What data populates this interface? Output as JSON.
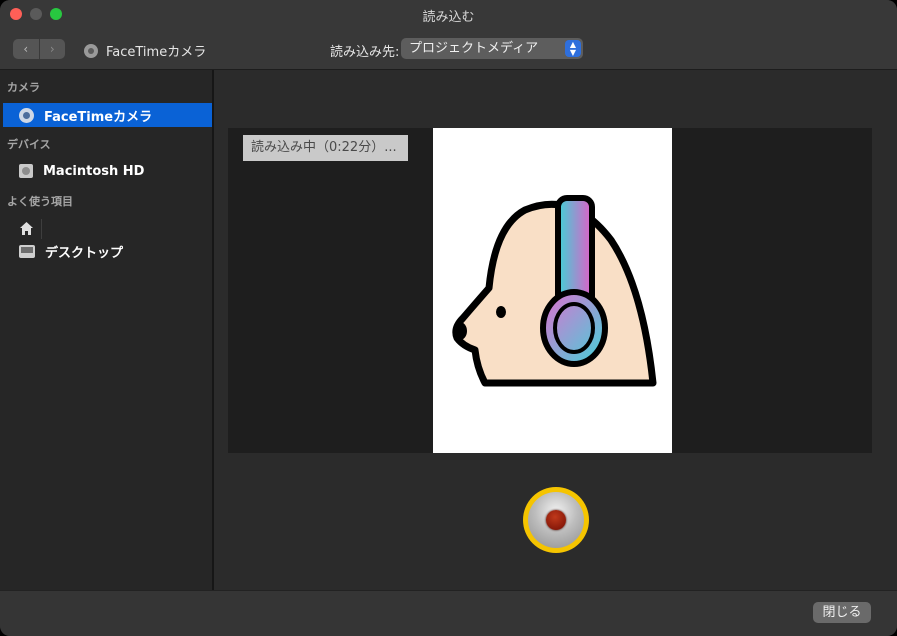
{
  "window": {
    "title": "読み込む"
  },
  "toolbar": {
    "back_icon": "chevron-left-icon",
    "forward_icon": "chevron-right-icon",
    "source_label": "FaceTimeカメラ",
    "destination_label": "読み込み先:",
    "destination_value": "プロジェクトメディア"
  },
  "sidebar": {
    "sections": [
      {
        "heading": "カメラ",
        "items": [
          {
            "label": "FaceTimeカメラ",
            "icon": "camera-icon",
            "selected": true
          }
        ]
      },
      {
        "heading": "デバイス",
        "items": [
          {
            "label": "Macintosh HD",
            "icon": "hard-drive-icon"
          }
        ]
      },
      {
        "heading": "よく使う項目",
        "items": [
          {
            "label": "",
            "icon": "home-icon"
          },
          {
            "label": "デスクトップ",
            "icon": "desktop-icon"
          }
        ]
      }
    ]
  },
  "preview": {
    "status": "読み込み中（0:22分）..."
  },
  "footer": {
    "close_label": "閉じる"
  },
  "colors": {
    "accent": "#0a62d6",
    "record_ring": "#f5c400",
    "record_dot": "#8a1a0a",
    "selected_blue": "#2f6fdc"
  }
}
